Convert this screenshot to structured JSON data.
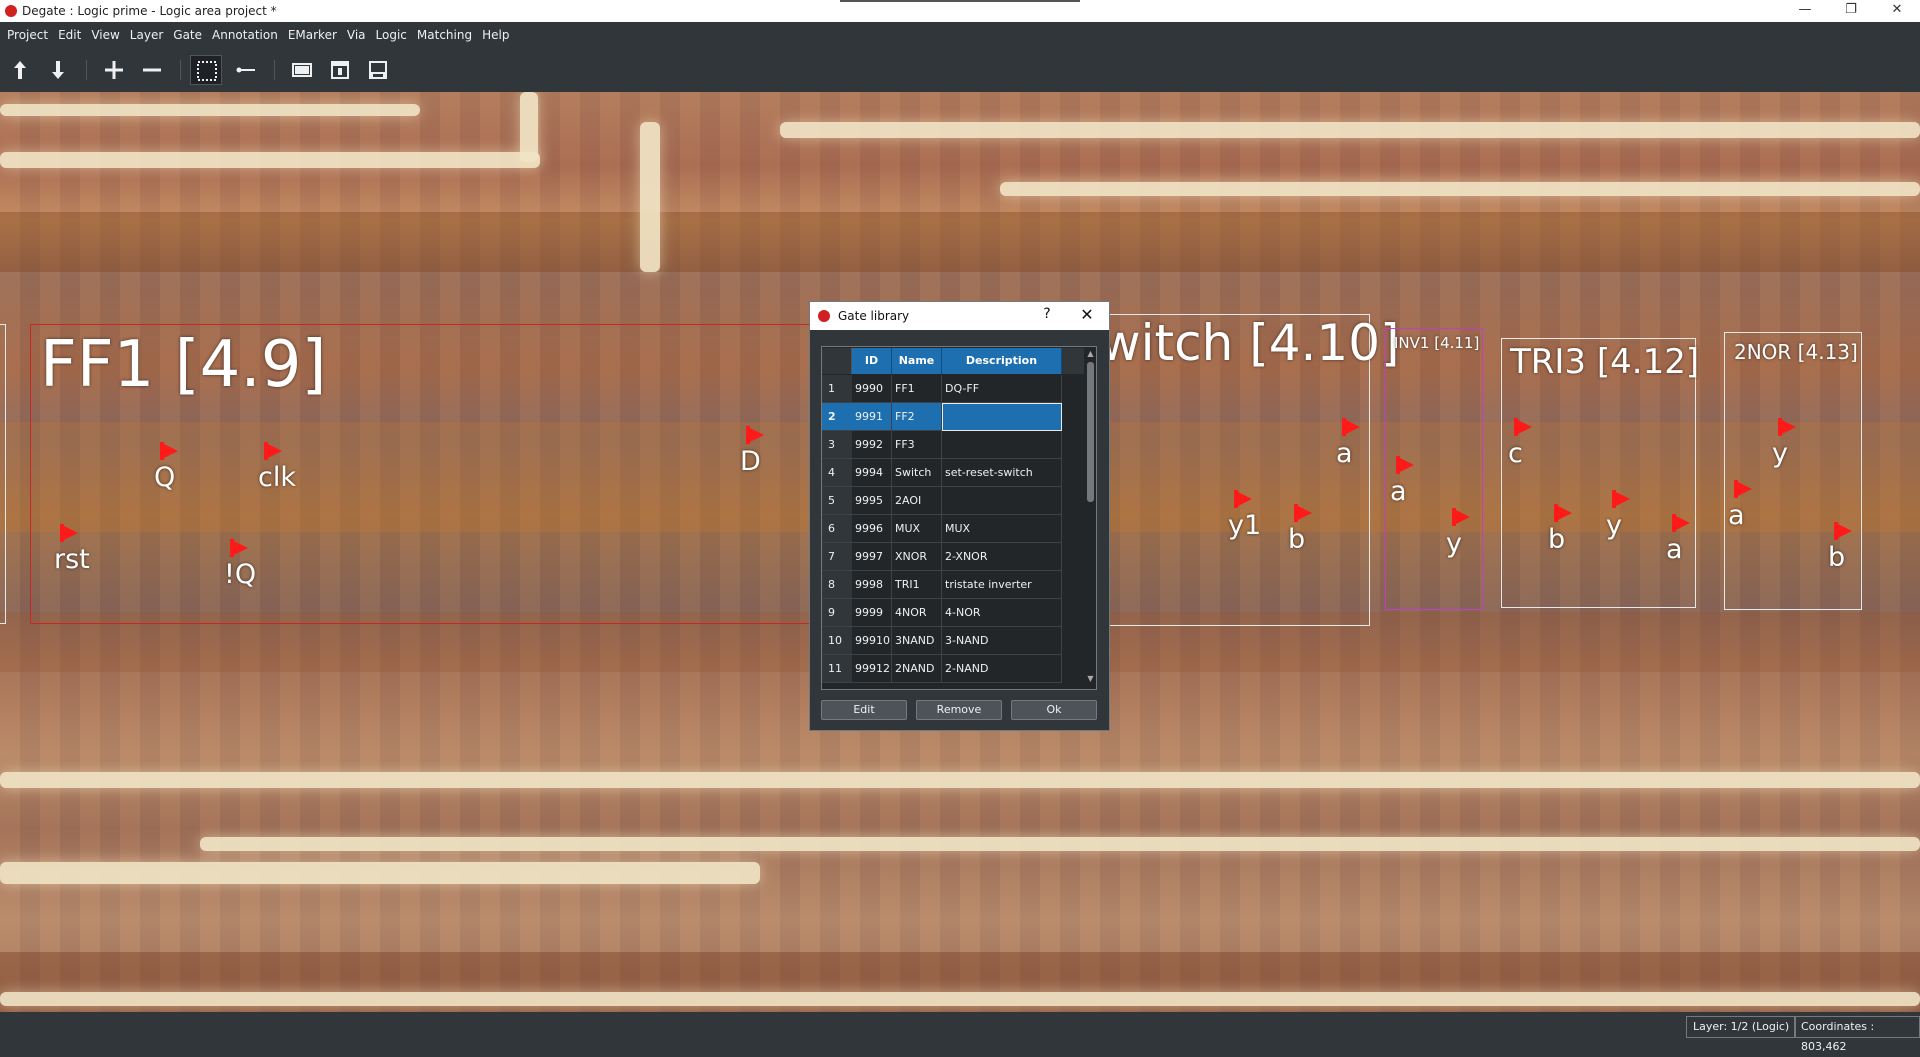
{
  "window": {
    "title": "Degate : Logic prime - Logic area project *",
    "controls": {
      "minimize": "—",
      "maximize": "❐",
      "close": "✕"
    }
  },
  "menubar": [
    "Project",
    "Edit",
    "View",
    "Layer",
    "Gate",
    "Annotation",
    "EMarker",
    "Via",
    "Logic",
    "Matching",
    "Help"
  ],
  "toolbar": {
    "icons": [
      "layer-up-icon",
      "layer-down-icon",
      "zoom-in-icon",
      "zoom-out-icon",
      "area-selection-icon",
      "wire-tool-icon",
      "view-background-icon",
      "view-gate-icon",
      "view-ports-icon"
    ],
    "active": "area-selection-icon"
  },
  "canvas": {
    "gates": [
      {
        "label": "FF1 [4.9]",
        "ports": [
          "Q",
          "clk",
          "D",
          "rst",
          "!Q"
        ]
      },
      {
        "label": "Switch [4.10]",
        "ports": [
          "a",
          "y1",
          "b"
        ]
      },
      {
        "label": "INV1 [4.11]",
        "ports": [
          "a",
          "y"
        ]
      },
      {
        "label": "TRI3 [4.12]",
        "ports": [
          "c",
          "b",
          "y",
          "a"
        ]
      },
      {
        "label": "2NOR [4.13]",
        "ports": [
          "y",
          "a",
          "b"
        ]
      }
    ],
    "colors": {
      "gate_box": "#e8e8e8",
      "ff_box": "#c62828",
      "inv_box": "#c040c0",
      "port": "#ff1a1a"
    }
  },
  "dialog": {
    "title": "Gate library",
    "help": "?",
    "close": "✕",
    "columns": [
      "ID",
      "Name",
      "Description"
    ],
    "rows": [
      {
        "n": "1",
        "id": "9990",
        "name": "FF1",
        "desc": "DQ-FF"
      },
      {
        "n": "2",
        "id": "9991",
        "name": "FF2",
        "desc": ""
      },
      {
        "n": "3",
        "id": "9992",
        "name": "FF3",
        "desc": ""
      },
      {
        "n": "4",
        "id": "9994",
        "name": "Switch",
        "desc": "set-reset-switch"
      },
      {
        "n": "5",
        "id": "9995",
        "name": "2AOI",
        "desc": ""
      },
      {
        "n": "6",
        "id": "9996",
        "name": "MUX",
        "desc": "MUX"
      },
      {
        "n": "7",
        "id": "9997",
        "name": "XNOR",
        "desc": "2-XNOR"
      },
      {
        "n": "8",
        "id": "9998",
        "name": "TRI1",
        "desc": "tristate inverter"
      },
      {
        "n": "9",
        "id": "9999",
        "name": "4NOR",
        "desc": "4-NOR"
      },
      {
        "n": "10",
        "id": "99910",
        "name": "3NAND",
        "desc": "3-NAND"
      },
      {
        "n": "11",
        "id": "99912",
        "name": "2NAND",
        "desc": "2-NAND"
      }
    ],
    "selected_row": 2,
    "buttons": {
      "edit": "Edit",
      "remove": "Remove",
      "ok": "Ok"
    },
    "accent": "#1d6fb0"
  },
  "statusbar": {
    "layer": "Layer: 1/2 (Logic)",
    "coordinates": "Coordinates : 803,462"
  }
}
